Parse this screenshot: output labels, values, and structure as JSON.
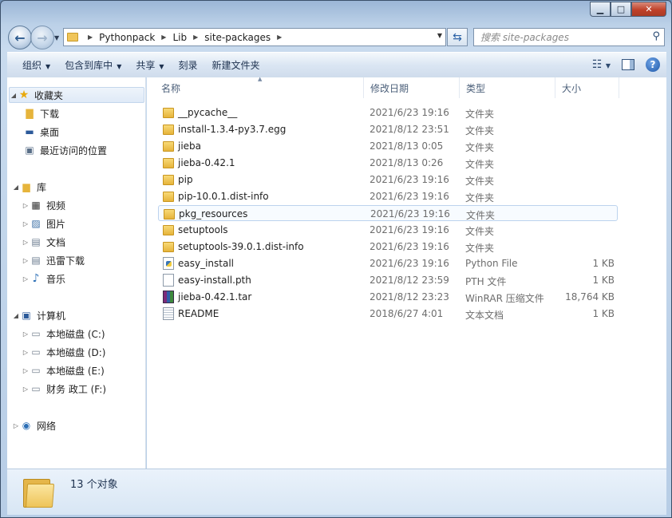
{
  "window": {
    "caption": {
      "minimize": "▁",
      "maximize": "□",
      "close": "✕"
    }
  },
  "address": {
    "crumbs": [
      "Pythonpack",
      "Lib",
      "site-packages"
    ]
  },
  "search": {
    "placeholder": "搜索 site-packages"
  },
  "toolbar": {
    "organize": "组织",
    "include_in_library": "包含到库中",
    "share": "共享",
    "burn": "刻录",
    "new_folder": "新建文件夹"
  },
  "nav_pane": {
    "favorites": "收藏夹",
    "downloads": "下载",
    "desktop": "桌面",
    "recent": "最近访问的位置",
    "libraries": "库",
    "videos": "视频",
    "pictures": "图片",
    "documents": "文档",
    "thunder": "迅雷下载",
    "music": "音乐",
    "computer": "计算机",
    "drive_c": "本地磁盘 (C:)",
    "drive_d": "本地磁盘 (D:)",
    "drive_e": "本地磁盘 (E:)",
    "drive_f": "财务  政工 (F:)",
    "network": "网络"
  },
  "columns": {
    "name": "名称",
    "date": "修改日期",
    "type": "类型",
    "size": "大小"
  },
  "files": [
    {
      "name": "__pycache__",
      "date": "2021/6/23 19:16",
      "type": "文件夹",
      "size": "",
      "icon": "folder"
    },
    {
      "name": "install-1.3.4-py3.7.egg",
      "date": "2021/8/12 23:51",
      "type": "文件夹",
      "size": "",
      "icon": "folder"
    },
    {
      "name": "jieba",
      "date": "2021/8/13 0:05",
      "type": "文件夹",
      "size": "",
      "icon": "folder"
    },
    {
      "name": "jieba-0.42.1",
      "date": "2021/8/13 0:26",
      "type": "文件夹",
      "size": "",
      "icon": "folder"
    },
    {
      "name": "pip",
      "date": "2021/6/23 19:16",
      "type": "文件夹",
      "size": "",
      "icon": "folder"
    },
    {
      "name": "pip-10.0.1.dist-info",
      "date": "2021/6/23 19:16",
      "type": "文件夹",
      "size": "",
      "icon": "folder"
    },
    {
      "name": "pkg_resources",
      "date": "2021/6/23 19:16",
      "type": "文件夹",
      "size": "",
      "icon": "folder"
    },
    {
      "name": "setuptools",
      "date": "2021/6/23 19:16",
      "type": "文件夹",
      "size": "",
      "icon": "folder"
    },
    {
      "name": "setuptools-39.0.1.dist-info",
      "date": "2021/6/23 19:16",
      "type": "文件夹",
      "size": "",
      "icon": "folder"
    },
    {
      "name": "easy_install",
      "date": "2021/6/23 19:16",
      "type": "Python File",
      "size": "1 KB",
      "icon": "python-file"
    },
    {
      "name": "easy-install.pth",
      "date": "2021/8/12 23:59",
      "type": "PTH 文件",
      "size": "1 KB",
      "icon": "file"
    },
    {
      "name": "jieba-0.42.1.tar",
      "date": "2021/8/12 23:23",
      "type": "WinRAR 压缩文件",
      "size": "18,764 KB",
      "icon": "archive"
    },
    {
      "name": "README",
      "date": "2018/6/27 4:01",
      "type": "文本文档",
      "size": "1 KB",
      "icon": "text-file"
    }
  ],
  "status": {
    "count": "13 个对象"
  }
}
